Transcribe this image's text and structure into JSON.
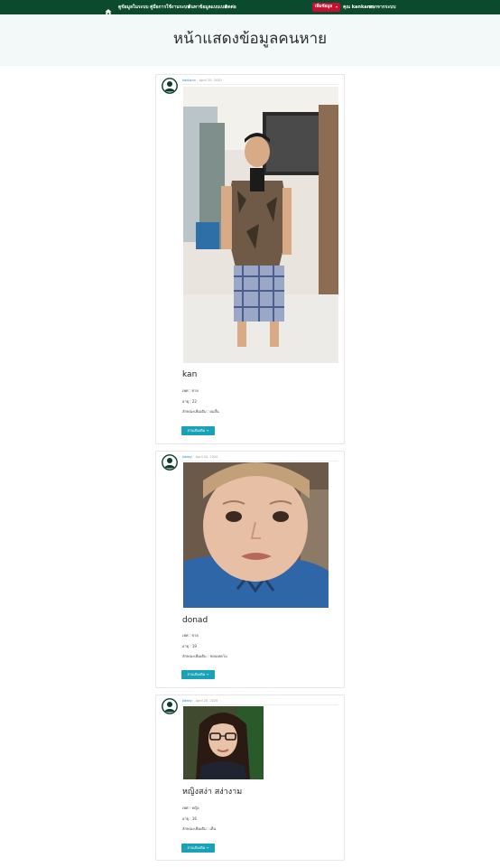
{
  "nav": {
    "links": [
      "ดูข้อมูลในระบบ",
      "คู่มือการใช้งานระบบ",
      "ค้นหาข้อมูลแบบเบล",
      "ติดต่อ"
    ],
    "dropdown_label": "เพิ่มข้อมูล",
    "user": "คุณ kankann",
    "logout": "ออกจากระบบ"
  },
  "hero": {
    "title": "หน้าแสดงข้อมูลคนหาย"
  },
  "posts": [
    {
      "author": "kankann",
      "date": "April 20, 2020",
      "name": "kan",
      "gender": "เพศ : ชาย",
      "age": "อายุ : 22",
      "note": "ลักษณะเพิ่มเติม : ผมสั้น",
      "button": "อ่านเพิ่มเติม →"
    },
    {
      "author": "Jiddey",
      "date": "April 20, 2020",
      "name": "donad",
      "gender": "เพศ : ชาย",
      "age": "อายุ : 19",
      "note": "ลักษณะเพิ่มเติม : ชอบเทคโน",
      "button": "อ่านเพิ่มเติม →"
    },
    {
      "author": "Jiddey",
      "date": "April 20, 2020",
      "name": "หญิงสง่า สง่างาม",
      "gender": "เพศ : หญิง",
      "age": "อายุ : 16",
      "note": "ลักษณะเพิ่มเติม : เต็น",
      "button": "อ่านเพิ่มเติม →"
    }
  ],
  "colors": {
    "navbar": "#0b4a2c",
    "dropdown": "#c8102e",
    "button": "#17a2b8",
    "link": "#1e88c8"
  },
  "icons": {
    "home": "home-icon",
    "avatar": "user-avatar-icon"
  }
}
